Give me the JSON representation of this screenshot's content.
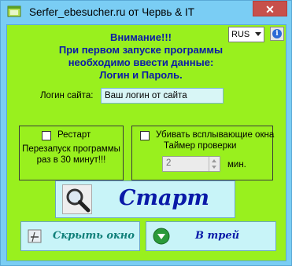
{
  "window": {
    "title": "Serfer_ebesucher.ru от Червь & IT",
    "close_glyph": "✕"
  },
  "language": {
    "selected": "RUS"
  },
  "info": {
    "glyph": "i"
  },
  "notice": {
    "lines": [
      "Внимание!!!",
      "При первом запуске программы",
      "необходимо ввести данные:",
      "Логин и Пароль."
    ]
  },
  "login": {
    "label": "Логин сайта:",
    "value": "Ваш логин от сайта"
  },
  "restart": {
    "checkbox_label": "Рестарт",
    "checked": false,
    "desc_lines": [
      "Перезапуск программы",
      "раз в 30 минут!!!"
    ]
  },
  "popups": {
    "checkbox_label": "Убивать всплывающие окна",
    "checked": false,
    "timer_label": "Таймер проверки",
    "timer_value": "2",
    "unit": "мин."
  },
  "buttons": {
    "start": "Старт",
    "hide": "Скрыть окно",
    "tray": "В трей"
  },
  "colors": {
    "titlebar": "#7acdf4",
    "client_bg": "#99f01e",
    "button_bg": "#c8f4f8",
    "accent_blue": "#0a1aa8",
    "hide_label": "#10807a",
    "close_red": "#c7504b"
  }
}
